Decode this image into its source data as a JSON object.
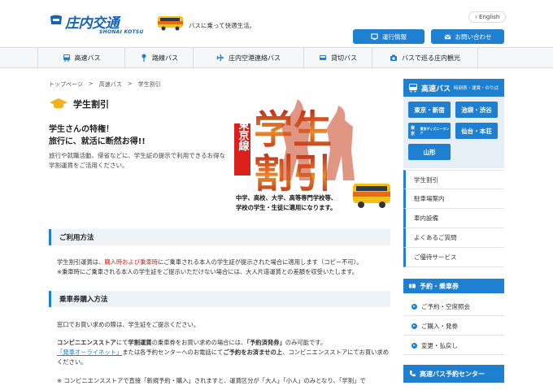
{
  "header": {
    "logo_jp": "庄内交通",
    "logo_en": "SHONAI KOTSU",
    "tagline": "バスに乗って快適生活。",
    "lang": "English",
    "buttons": [
      "運行情報",
      "お問い合わせ"
    ]
  },
  "nav": {
    "items": [
      "高速バス",
      "路線バス",
      "庄内空港連絡バス",
      "貸切バス",
      "バスで巡る庄内観光"
    ]
  },
  "breadcrumb": [
    "トップページ",
    ">",
    "高速バス",
    ">",
    "学生割引"
  ],
  "main": {
    "title": "学生割引",
    "lead_1": "学生さんの特権！",
    "lead_2": "旅行に、就活に断然お得!!",
    "intro": "旅行や就職活動、帰省などに、学生証の提示で利用できるお得な学割運賃をご活用ください。",
    "banner": {
      "badge": "東京線",
      "big_1": "学生",
      "big_2": "割引",
      "caption_1": "中学、高校、大学、高等専門学校等、",
      "caption_2": "学校の学生・生徒に適用になります。"
    },
    "section_usage": "ご利用方法",
    "usage_p1_a": "学生割引運賃は、",
    "usage_p1_red": "購入時および乗車時",
    "usage_p1_b": "にご乗車される本人の学生証が提示された場合に適用します（コピー不可）。",
    "usage_p2": "※乗車時にご乗車される本人の学生証をご提示いただけない場合には、大人片道運賃との差額を収受いたします。",
    "section_purchase": "乗車券購入方法",
    "purchase_p1": "窓口でお買い求めの際は、学生証をご提示ください。",
    "purchase_p2_a": "コンビニエンスストア",
    "purchase_p2_b": "にて",
    "purchase_p2_c": "学割運賃",
    "purchase_p2_d": "の乗車券をお買い求めの場合には、",
    "purchase_p2_e": "「予約済発券」",
    "purchase_p2_f": "のみ可能です。",
    "purchase_p3_link": "「発車オーライネット」",
    "purchase_p3_a": "または各予約センターへのお電話にて",
    "purchase_p3_b": "ご予約をお済ませの上",
    "purchase_p3_c": "、コンビニエンスストアにてお買い求めください。",
    "purchase_p4": "※ コンビニエンスストアで直接「新規予約・購入」されますと、運賃区分が「大人」「小人」のみとなり、「学割」で"
  },
  "sidebar": {
    "head_big": "高速バス",
    "head_small": "時刻表・運賃・のりば",
    "routes": [
      "東京・新宿",
      "池袋・渋谷",
      "東京ディズニーランド",
      "仙台・本荘",
      "山形"
    ],
    "route3_prefix": "東京",
    "links": [
      "学生割引",
      "駐車場案内",
      "車内設備",
      "よくあるご質問",
      "ご優待サービス"
    ],
    "head2": "予約・乗車券",
    "sub": [
      "ご予約・空席照会",
      "ご購入・発券",
      "変更・払戻し"
    ],
    "head3": "高速バス予約センター"
  },
  "colors": {
    "accent": "#1f7fd0",
    "red": "#e0201b",
    "banner_red": "#d9201b"
  }
}
